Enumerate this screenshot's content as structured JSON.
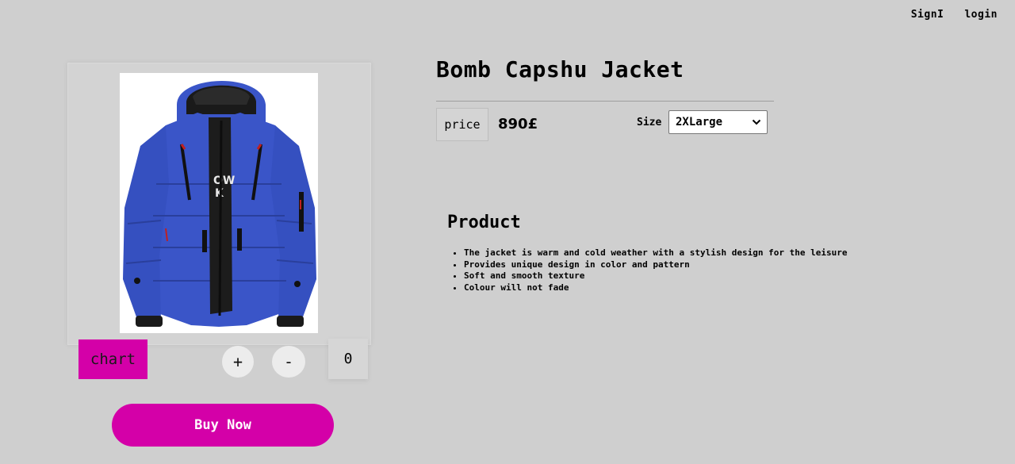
{
  "nav": {
    "signin_label": "SignI",
    "login_label": "login"
  },
  "product": {
    "title": "Bomb Capshu Jacket",
    "image_icon": "blue-puffer-jacket-image",
    "price_label": "price",
    "price_value": "890£",
    "size_label": "Size",
    "size_selected": "2XLarge",
    "description_title": "Product",
    "features": [
      "The jacket is warm and cold weather with a stylish design for the leisure",
      "Provides unique design in color and pattern",
      "Soft and smooth texture",
      "Colour will not fade"
    ]
  },
  "cart": {
    "chart_label": "chart",
    "plus_label": "+",
    "minus_label": "-",
    "quantity": "0",
    "buy_label": "Buy Now"
  },
  "colors": {
    "background": "#cfcfcf",
    "accent": "#d400a8",
    "jacket_blue": "#3a55c8"
  }
}
